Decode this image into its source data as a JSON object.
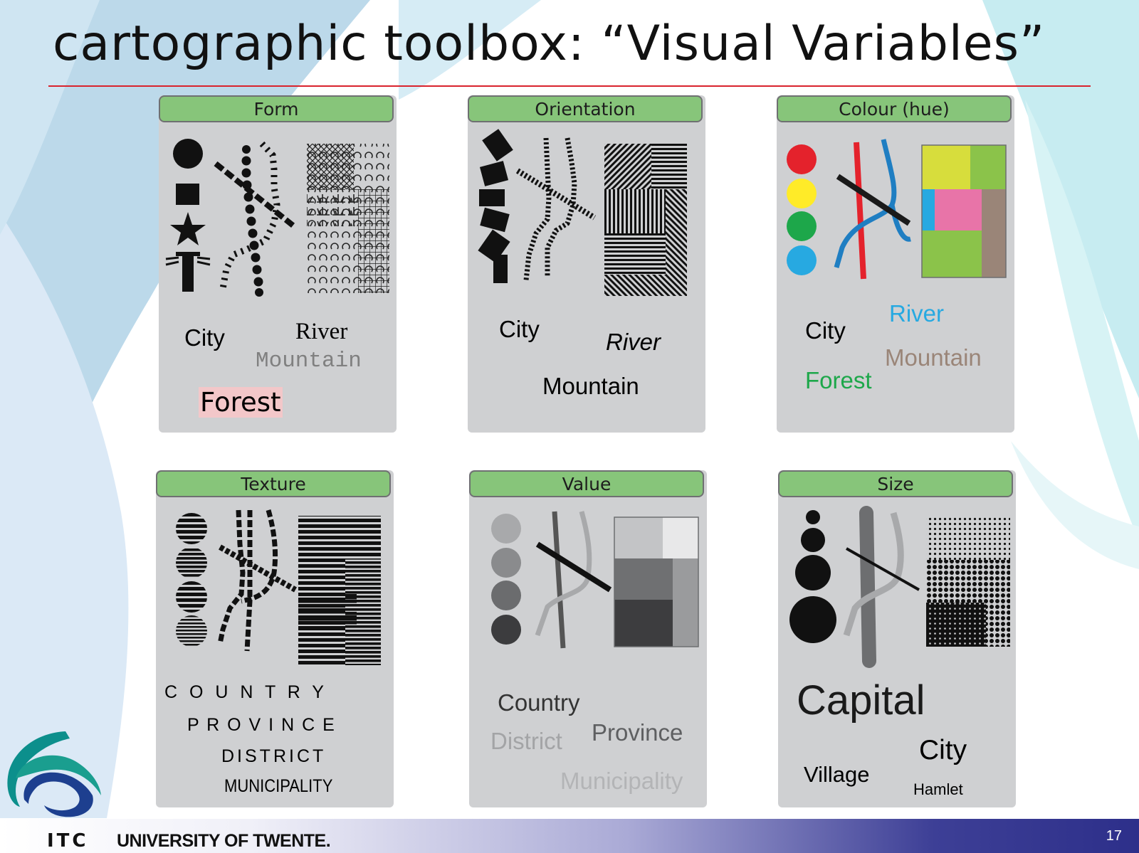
{
  "slide": {
    "title": "cartographic toolbox: “Visual Variables”",
    "page_number": "17",
    "footer": {
      "itc": "ITC",
      "university": "UNIVERSITY OF TWENTE."
    }
  },
  "colors": {
    "header_green": "#87c57a",
    "panel_gray": "#cfd0d2",
    "title_rule": "#d9232d",
    "red": "#e4222c",
    "yellow": "#ffeb28",
    "green": "#1da74a",
    "blue": "#27a9e1",
    "brown": "#9a8578",
    "pink": "#e874a8"
  },
  "panels": {
    "form": {
      "title": "Form",
      "labels": {
        "city": "City",
        "river": "River",
        "mountain": "Mountain",
        "forest": "Forest"
      }
    },
    "orientation": {
      "title": "Orientation",
      "labels": {
        "city": "City",
        "river": "River",
        "mountain": "Mountain"
      }
    },
    "colour": {
      "title": "Colour (hue)",
      "labels": {
        "river": "River",
        "city": "City",
        "mountain": "Mountain",
        "forest": "Forest"
      }
    },
    "texture": {
      "title": "Texture",
      "labels": {
        "country": "C O U N T R Y",
        "province": "P R O V I N C E",
        "district": "DISTRICT",
        "municipality": "MUNICIPALITY"
      }
    },
    "value": {
      "title": "Value",
      "labels": {
        "country": "Country",
        "district": "District",
        "province": "Province",
        "municipality": "Municipality"
      }
    },
    "size": {
      "title": "Size",
      "labels": {
        "capital": "Capital",
        "city": "City",
        "village": "Village",
        "hamlet": "Hamlet"
      }
    }
  }
}
